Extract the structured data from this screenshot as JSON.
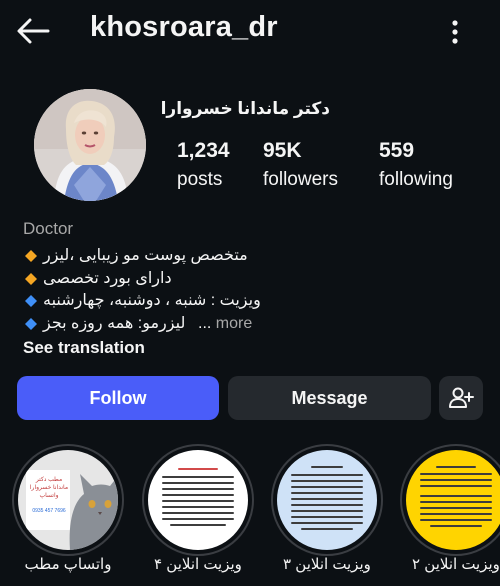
{
  "header": {
    "username": "khosroara_dr",
    "back_icon": "arrow-left-icon",
    "menu_icon": "more-vertical-icon"
  },
  "profile": {
    "full_name": "دکتر ماندانا خسروارا",
    "stats": [
      {
        "value": "1,234",
        "label": "posts"
      },
      {
        "value": "95K",
        "label": "followers"
      },
      {
        "value": "559",
        "label": "following"
      }
    ],
    "category": "Doctor",
    "bio_lines": [
      {
        "icon": "orange-diamond-icon",
        "color": "#f5a623",
        "text": "متخصص پوست مو زیبایی ،لیزر"
      },
      {
        "icon": "orange-diamond-icon",
        "color": "#f5a623",
        "text": "دارای بورد تخصصی"
      },
      {
        "icon": "blue-diamond-icon",
        "color": "#3f8ff7",
        "text": "ویزیت : شنبه ، دوشنبه، چهارشنبه"
      },
      {
        "icon": "blue-diamond-icon",
        "color": "#3f8ff7",
        "text": "لیزرمو: همه روزه بجز"
      }
    ],
    "more_dots": "...",
    "more_label": "more",
    "see_translation": "See translation"
  },
  "actions": {
    "follow_label": "Follow",
    "message_label": "Message",
    "add_user_icon": "person-add-icon",
    "accent_color": "#4a5df9"
  },
  "highlights": [
    {
      "caption": "واتساپ مطب",
      "cover_text": [
        "مطب دکتر",
        "ماندانا خسروارا",
        "واتساپ",
        "0935 457 7696"
      ]
    },
    {
      "caption": "ویزیت انلاین ۴"
    },
    {
      "caption": "ویزیت انلاین ۳"
    },
    {
      "caption": "ویزیت انلاین ۲"
    }
  ]
}
